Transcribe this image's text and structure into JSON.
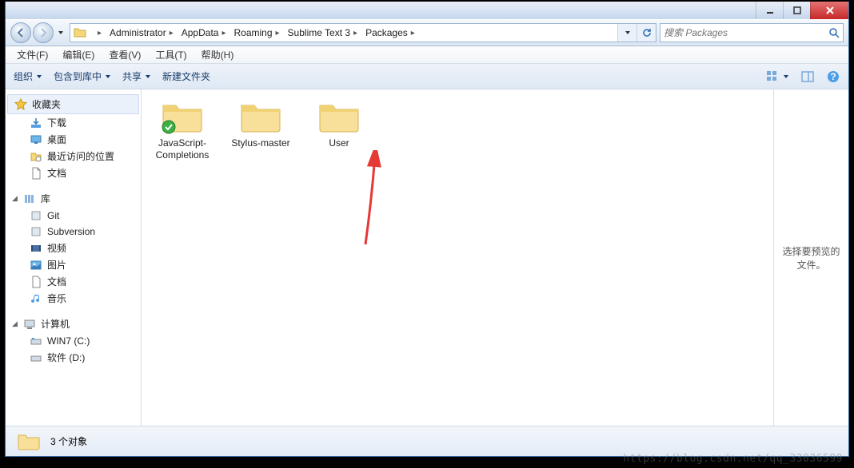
{
  "breadcrumbs": [
    "Administrator",
    "AppData",
    "Roaming",
    "Sublime Text 3",
    "Packages"
  ],
  "search_placeholder": "搜索 Packages",
  "menus": {
    "file": "文件(F)",
    "edit": "编辑(E)",
    "view": "查看(V)",
    "tools": "工具(T)",
    "help": "帮助(H)"
  },
  "toolbar": {
    "organize": "组织",
    "include": "包含到库中",
    "share": "共享",
    "newfolder": "新建文件夹"
  },
  "sidebar": {
    "favorites": {
      "label": "收藏夹",
      "items": [
        {
          "label": "下载"
        },
        {
          "label": "桌面"
        },
        {
          "label": "最近访问的位置"
        },
        {
          "label": "文档"
        }
      ]
    },
    "libraries": {
      "label": "库",
      "items": [
        {
          "label": "Git"
        },
        {
          "label": "Subversion"
        },
        {
          "label": "视频"
        },
        {
          "label": "图片"
        },
        {
          "label": "文档"
        },
        {
          "label": "音乐"
        }
      ]
    },
    "computer": {
      "label": "计算机",
      "items": [
        {
          "label": "WIN7 (C:)"
        },
        {
          "label": "软件 (D:)"
        }
      ]
    }
  },
  "folders": [
    {
      "name": "JavaScript-Completions",
      "badge": "check"
    },
    {
      "name": "Stylus-master"
    },
    {
      "name": "User"
    }
  ],
  "preview_text": "选择要预览的文件。",
  "status": "3 个对象",
  "watermark": "https://blog.csdn.net/qq_33036599"
}
